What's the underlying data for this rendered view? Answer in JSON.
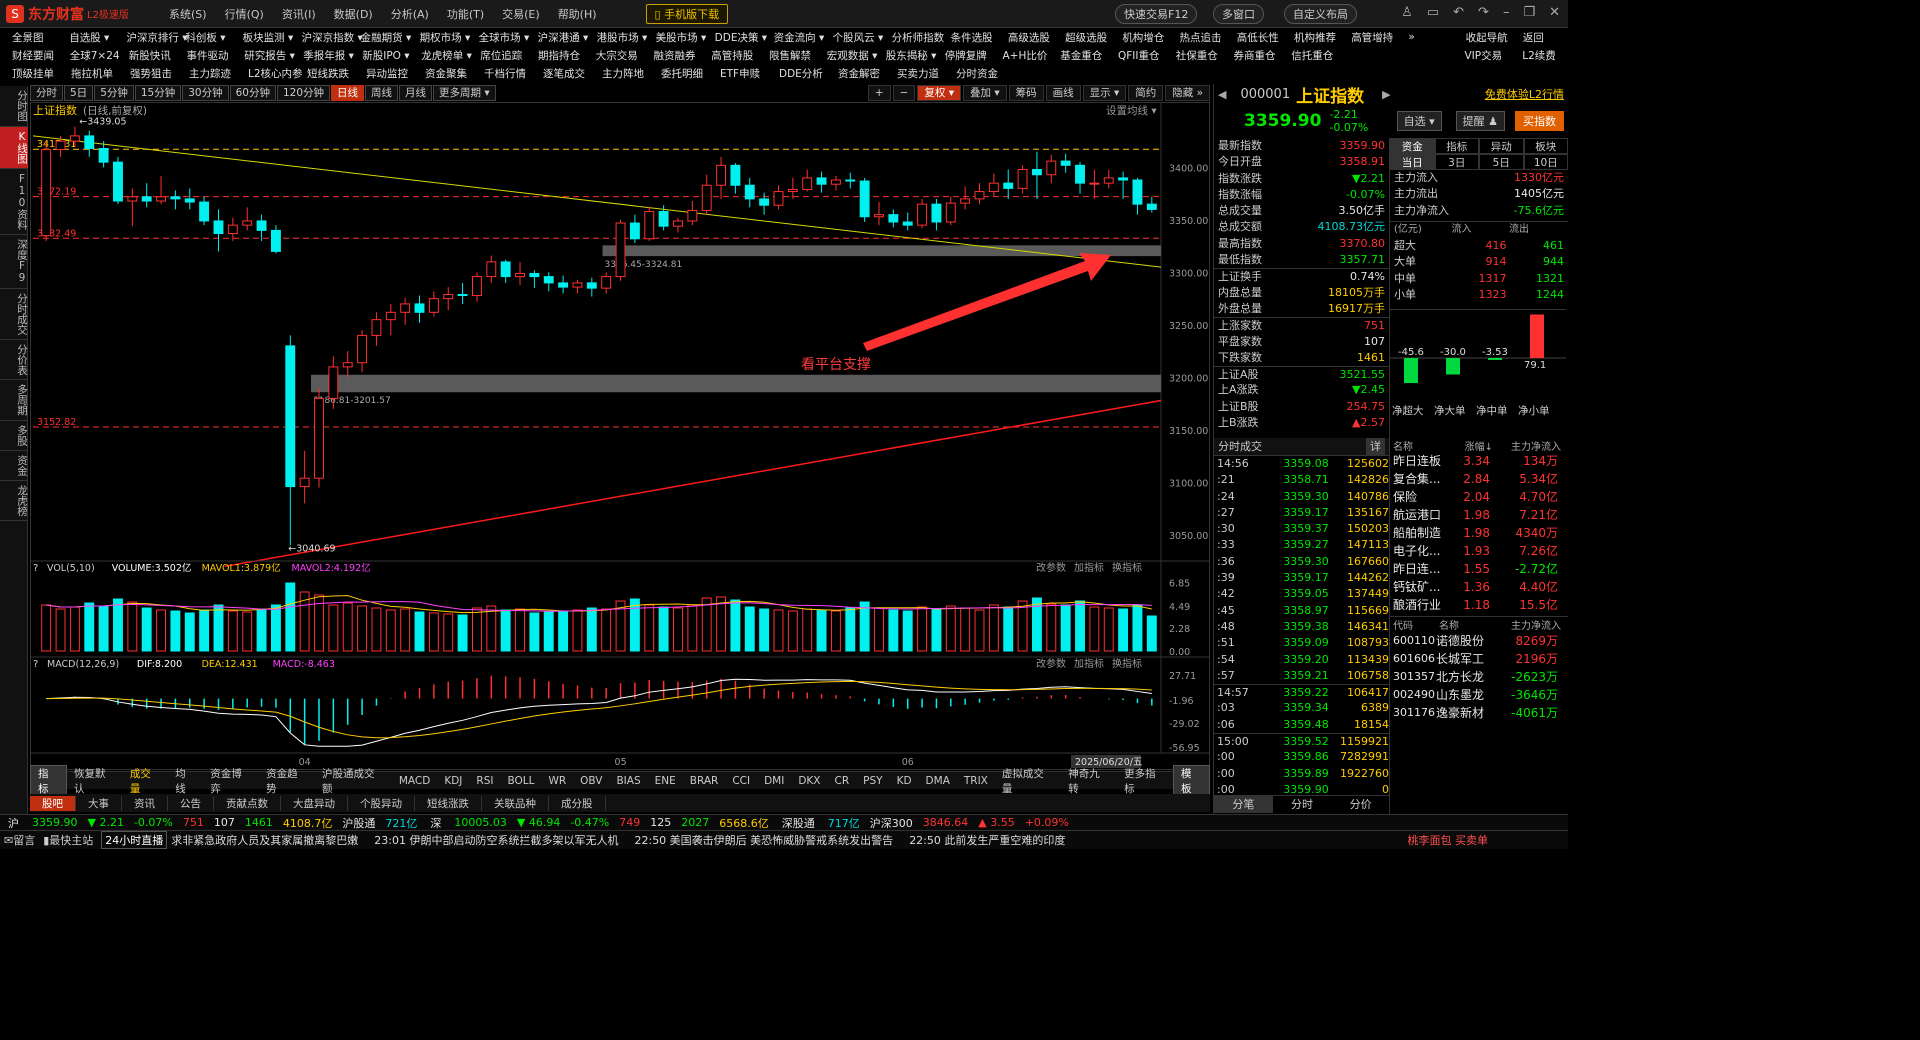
{
  "app": {
    "logo_icon": "S",
    "name": "东方财富",
    "version": "L2极速版",
    "menu": [
      "系统(S)",
      "行情(Q)",
      "资讯(I)",
      "数据(D)",
      "分析(A)",
      "功能(T)",
      "交易(E)",
      "帮助(H)"
    ],
    "mobile_download": "手机版下载",
    "quick_trade": "快速交易F12",
    "multi_window": "多窗口",
    "custom_layout": "自定义布局"
  },
  "nav_row1": [
    "全景图",
    "自选股 ▾",
    "沪深京排行 ▾",
    "科创板 ▾",
    "板块监测 ▾",
    "沪深京指数 ▾",
    "金融期货 ▾",
    "期权市场 ▾",
    "全球市场 ▾",
    "沪深港通 ▾",
    "港股市场 ▾",
    "美股市场 ▾",
    "DDE决策 ▾",
    "资金流向 ▾",
    "个股风云 ▾",
    "分析师指数",
    "条件选股",
    "高级选股",
    "超级选股",
    "机构增仓",
    "热点追击",
    "高低长性",
    "机构推荐",
    "高管增持",
    "»",
    "收起导航",
    "返回"
  ],
  "nav_row2": [
    "财经要闻",
    "全球7×24",
    "新股快讯",
    "事件驱动",
    "研究报告 ▾",
    "季报年报 ▾",
    "新股IPO ▾",
    "龙虎榜单 ▾",
    "席位追踪",
    "期指持仓",
    "大宗交易",
    "融资融券",
    "高管持股",
    "限售解禁",
    "宏观数据 ▾",
    "股东揭秘 ▾",
    "停牌复牌",
    "A+H比价",
    "基金重仓",
    "QFII重仓",
    "社保重仓",
    "券商重仓",
    "信托重仓",
    "",
    "",
    "VIP交易",
    "L2续费"
  ],
  "nav_row3": [
    "顶级挂单",
    "拖拉机单",
    "强势狙击",
    "主力踪迹",
    "L2核心内参",
    "短线跌跌",
    "异动监控",
    "资金聚集",
    "千档行情",
    "逐笔成交",
    "主力阵地",
    "委托明细",
    "ETF申赎",
    "DDE分析",
    "资金解密",
    "买卖力道",
    "分时资金"
  ],
  "left_tabs": [
    "分时图",
    "K线图",
    "F10资料",
    "深度F9",
    "分时成交",
    "分价表",
    "多周期",
    "多股",
    "资金",
    "龙虎榜"
  ],
  "toolbar": {
    "periods": [
      "分时",
      "5日",
      "5分钟",
      "15分钟",
      "30分钟",
      "60分钟",
      "120分钟",
      "日线",
      "周线",
      "月线",
      "更多周期 ▾"
    ],
    "active_period": "日线",
    "tools": [
      "+",
      "−",
      "复权 ▾",
      "叠加 ▾",
      "筹码",
      "画线",
      "显示 ▾",
      "简约",
      "隐藏 »"
    ]
  },
  "chart": {
    "title": "上证指数",
    "subtitle": "(日线,前复权)",
    "settings": "设置均线 ▾",
    "annotation": "看平台支撑",
    "ylabels": [
      "3400.00",
      "3350.00",
      "3300.00",
      "3250.00",
      "3200.00",
      "3150.00",
      "3100.00",
      "3050.00"
    ],
    "yvalues": [
      3400,
      3350,
      3300,
      3250,
      3200,
      3150,
      3100,
      3050
    ],
    "levels": [
      {
        "value": 3417.31,
        "label": "3417.31",
        "color": "#ffcc00"
      },
      {
        "value": 3372.19,
        "label": "3372.19",
        "color": "#ff3030"
      },
      {
        "value": 3332.49,
        "label": "3332.49",
        "color": "#ff3030"
      },
      {
        "value": 3152.82,
        "label": "3152.82",
        "color": "#ff3030"
      }
    ],
    "zones": [
      {
        "low": 3316.45,
        "high": 3324.81,
        "label": "3316.45-3324.81"
      },
      {
        "low": 3186.81,
        "high": 3201.57,
        "label": "3186.81-3201.57"
      }
    ],
    "high_label": "3439.05",
    "low_label": "3040.69",
    "xlabels": [
      "04",
      "05",
      "06"
    ],
    "date_label": "2025/06/20/五",
    "vol_header": [
      {
        "t": "VOL(5,10)",
        "c": "#ccc"
      },
      {
        "t": "VOLUME:3.502亿",
        "c": "#fff"
      },
      {
        "t": "MAVOL1:3.879亿",
        "c": "#ffcc00"
      },
      {
        "t": "MAVOL2:4.192亿",
        "c": "#ff40ff"
      }
    ],
    "vol_ylabels": [
      "6.85",
      "4.49",
      "2.28",
      "0.00"
    ],
    "macd_header": [
      {
        "t": "MACD(12,26,9)",
        "c": "#ccc"
      },
      {
        "t": "DIF:8.200",
        "c": "#fff"
      },
      {
        "t": "DEA:12.431",
        "c": "#ffcc00"
      },
      {
        "t": "MACD:-8.463",
        "c": "#ff40ff"
      }
    ],
    "macd_ylabels": [
      "27.71",
      "-1.96",
      "-29.02",
      "-56.95"
    ],
    "sub_tools": [
      "改参数",
      "加指标",
      "换指标"
    ]
  },
  "chart_data": {
    "type": "candlestick",
    "candles": [
      [
        3335,
        3417,
        3425,
        3330
      ],
      [
        3417,
        3425,
        3430,
        3410
      ],
      [
        3425,
        3430,
        3439,
        3420
      ],
      [
        3430,
        3418,
        3435,
        3410
      ],
      [
        3418,
        3405,
        3425,
        3400
      ],
      [
        3405,
        3368,
        3410,
        3365
      ],
      [
        3368,
        3372,
        3380,
        3344
      ],
      [
        3372,
        3368,
        3385,
        3362
      ],
      [
        3368,
        3372,
        3392,
        3365
      ],
      [
        3372,
        3370,
        3378,
        3360
      ],
      [
        3370,
        3367,
        3380,
        3360
      ],
      [
        3367,
        3349,
        3372,
        3345
      ],
      [
        3349,
        3337,
        3360,
        3320
      ],
      [
        3337,
        3345,
        3352,
        3330
      ],
      [
        3345,
        3349,
        3362,
        3340
      ],
      [
        3349,
        3340,
        3355,
        3330
      ],
      [
        3340,
        3320,
        3345,
        3318
      ],
      [
        3230,
        3096,
        3240,
        3040
      ],
      [
        3096,
        3104,
        3130,
        3080
      ],
      [
        3104,
        3180,
        3190,
        3095
      ],
      [
        3180,
        3210,
        3220,
        3170
      ],
      [
        3210,
        3214,
        3225,
        3200
      ],
      [
        3214,
        3240,
        3245,
        3205
      ],
      [
        3240,
        3255,
        3262,
        3230
      ],
      [
        3255,
        3262,
        3270,
        3240
      ],
      [
        3262,
        3270,
        3276,
        3250
      ],
      [
        3270,
        3262,
        3278,
        3252
      ],
      [
        3262,
        3275,
        3282,
        3258
      ],
      [
        3275,
        3279,
        3286,
        3264
      ],
      [
        3279,
        3278,
        3290,
        3270
      ],
      [
        3278,
        3296,
        3300,
        3272
      ],
      [
        3296,
        3310,
        3316,
        3290
      ],
      [
        3310,
        3296,
        3312,
        3290
      ],
      [
        3296,
        3299,
        3310,
        3288
      ],
      [
        3299,
        3296,
        3302,
        3285
      ],
      [
        3296,
        3290,
        3300,
        3282
      ],
      [
        3290,
        3286,
        3297,
        3280
      ],
      [
        3286,
        3290,
        3293,
        3280
      ],
      [
        3290,
        3285,
        3295,
        3277
      ],
      [
        3285,
        3296,
        3300,
        3280
      ],
      [
        3296,
        3347,
        3350,
        3292
      ],
      [
        3347,
        3332,
        3355,
        3328
      ],
      [
        3332,
        3358,
        3362,
        3330
      ],
      [
        3358,
        3344,
        3364,
        3340
      ],
      [
        3344,
        3349,
        3352,
        3338
      ],
      [
        3349,
        3359,
        3368,
        3345
      ],
      [
        3359,
        3383,
        3393,
        3355
      ],
      [
        3383,
        3402,
        3410,
        3370
      ],
      [
        3402,
        3383,
        3404,
        3375
      ],
      [
        3383,
        3370,
        3390,
        3362
      ],
      [
        3370,
        3364,
        3376,
        3355
      ],
      [
        3364,
        3377,
        3383,
        3360
      ],
      [
        3377,
        3379,
        3390,
        3370
      ],
      [
        3379,
        3390,
        3398,
        3377
      ],
      [
        3390,
        3384,
        3396,
        3376
      ],
      [
        3384,
        3388,
        3392,
        3378
      ],
      [
        3388,
        3387,
        3395,
        3380
      ],
      [
        3387,
        3353,
        3390,
        3348
      ],
      [
        3353,
        3355,
        3367,
        3345
      ],
      [
        3355,
        3348,
        3360,
        3343
      ],
      [
        3348,
        3345,
        3357,
        3340
      ],
      [
        3345,
        3365,
        3370,
        3342
      ],
      [
        3365,
        3348,
        3370,
        3340
      ],
      [
        3348,
        3366,
        3372,
        3345
      ],
      [
        3366,
        3370,
        3382,
        3360
      ],
      [
        3370,
        3377,
        3385,
        3365
      ],
      [
        3377,
        3385,
        3394,
        3372
      ],
      [
        3385,
        3380,
        3398,
        3370
      ],
      [
        3380,
        3398,
        3402,
        3375
      ],
      [
        3398,
        3393,
        3415,
        3370
      ],
      [
        3393,
        3406,
        3412,
        3385
      ],
      [
        3406,
        3402,
        3413,
        3395
      ],
      [
        3402,
        3385,
        3405,
        3375
      ],
      [
        3385,
        3385,
        3398,
        3370
      ],
      [
        3385,
        3390,
        3398,
        3380
      ],
      [
        3390,
        3388,
        3396,
        3370
      ],
      [
        3388,
        3365,
        3390,
        3355
      ],
      [
        3365,
        3360,
        3372,
        3357
      ]
    ],
    "vol": [
      4.6,
      4.2,
      4.4,
      4.8,
      4.5,
      5.2,
      4.9,
      4.3,
      4.1,
      4.0,
      3.8,
      4.1,
      4.6,
      4.0,
      3.9,
      4.2,
      4.6,
      6.8,
      5.9,
      5.6,
      4.6,
      4.8,
      4.5,
      4.3,
      4.1,
      4.2,
      3.9,
      3.8,
      3.7,
      3.6,
      4.3,
      4.5,
      4.1,
      4.2,
      3.8,
      3.9,
      4.0,
      4.1,
      4.3,
      4.2,
      5.0,
      5.2,
      4.6,
      4.4,
      4.3,
      4.6,
      5.3,
      5.4,
      5.1,
      4.4,
      4.2,
      4.1,
      4.0,
      4.2,
      4.1,
      4.0,
      4.3,
      4.9,
      4.3,
      4.1,
      4.0,
      4.4,
      4.2,
      4.5,
      4.3,
      4.1,
      4.6,
      4.4,
      5.0,
      5.3,
      4.7,
      4.6,
      5.0,
      4.4,
      4.3,
      4.2,
      4.6,
      3.5
    ],
    "trend_down": [
      [
        3430,
        0
      ],
      [
        3305,
        1
      ]
    ],
    "trend_up": [
      [
        3020,
        0.17
      ],
      [
        3178,
        1
      ]
    ]
  },
  "quote": {
    "code": "000001",
    "name": "上证指数",
    "price": "3359.90",
    "change": "-2.21",
    "pct": "-0.07%",
    "l2_link": "免费体验L2行情",
    "watch": "自选 ▾",
    "alert": "提醒 ♟",
    "buy": "买指数"
  },
  "quote_rows": [
    {
      "k": "最新指数",
      "v": "3359.90",
      "c": "red"
    },
    {
      "k": "今日开盘",
      "v": "3358.91",
      "c": "red"
    },
    {
      "k": "指数涨跌",
      "v": "▼2.21",
      "c": "green"
    },
    {
      "k": "指数涨幅",
      "v": "-0.07%",
      "c": "green"
    },
    {
      "k": "总成交量",
      "v": "3.50亿手",
      "c": "white"
    },
    {
      "k": "总成交额",
      "v": "4108.73亿元",
      "c": "cyan"
    },
    {
      "k": "最高指数",
      "v": "3370.80",
      "c": "red"
    },
    {
      "k": "最低指数",
      "v": "3357.71",
      "c": "green"
    },
    {
      "k": "上证换手",
      "v": "0.74%",
      "c": "white"
    },
    {
      "k": "内盘总量",
      "v": "18105万手",
      "c": "yellow"
    },
    {
      "k": "外盘总量",
      "v": "16917万手",
      "c": "yellow"
    },
    {
      "k": "上涨家数",
      "v": "751",
      "c": "red"
    },
    {
      "k": "平盘家数",
      "v": "107",
      "c": "white"
    },
    {
      "k": "下跌家数",
      "v": "1461",
      "c": "yellow"
    },
    {
      "k": "上证A股",
      "v": "3521.55",
      "c": "green"
    },
    {
      "k": "上A涨跌",
      "v": "▼2.45",
      "c": "green"
    },
    {
      "k": "上证B股",
      "v": "254.75",
      "c": "red"
    },
    {
      "k": "上B涨跌",
      "v": "▲2.57",
      "c": "red"
    }
  ],
  "fund_tabs": [
    "资金",
    "指标",
    "异动",
    "板块"
  ],
  "fund_period": [
    "当日",
    "3日",
    "5日",
    "10日"
  ],
  "fund_rows": [
    {
      "k": "主力流入",
      "v": "1330亿元",
      "c": "red"
    },
    {
      "k": "主力流出",
      "v": "1405亿元",
      "c": "white"
    },
    {
      "k": "主力净流入",
      "v": "-75.6亿元",
      "c": "green"
    }
  ],
  "flow_header": [
    "(亿元)",
    "流入",
    "流出"
  ],
  "flow_rows": [
    [
      "超大",
      "416",
      "461"
    ],
    [
      "大单",
      "914",
      "944"
    ],
    [
      "中单",
      "1317",
      "1321"
    ],
    [
      "小单",
      "1323",
      "1244"
    ]
  ],
  "net_bars": {
    "values": [
      -45.6,
      -30.0,
      -3.53,
      79.1
    ],
    "labels": [
      "-45.6",
      "-30.0",
      "-3.53",
      "79.1"
    ],
    "names": [
      "净超大",
      "净大单",
      "净中单",
      "净小单"
    ]
  },
  "ticks_title": "分时成交",
  "ticks_more": "详",
  "ticks": [
    [
      "14:56",
      "3359.08",
      "125602"
    ],
    [
      ":21",
      "3358.71",
      "142826"
    ],
    [
      ":24",
      "3359.30",
      "140786"
    ],
    [
      ":27",
      "3359.17",
      "135167"
    ],
    [
      ":30",
      "3359.37",
      "150203"
    ],
    [
      ":33",
      "3359.27",
      "147113"
    ],
    [
      ":36",
      "3359.30",
      "167660"
    ],
    [
      ":39",
      "3359.17",
      "144262"
    ],
    [
      ":42",
      "3359.05",
      "137449"
    ],
    [
      ":45",
      "3358.97",
      "115669"
    ],
    [
      ":48",
      "3359.38",
      "146341"
    ],
    [
      ":51",
      "3359.09",
      "108793"
    ],
    [
      ":54",
      "3359.20",
      "113439"
    ],
    [
      ":57",
      "3359.21",
      "106758"
    ],
    [
      "14:57",
      "3359.22",
      "106417"
    ],
    [
      ":03",
      "3359.34",
      "6389"
    ],
    [
      ":06",
      "3359.48",
      "18154"
    ],
    [
      "15:00",
      "3359.52",
      "1159921"
    ],
    [
      ":00",
      "3359.86",
      "7282991"
    ],
    [
      ":00",
      "3359.89",
      "1922760"
    ],
    [
      ":00",
      "3359.90",
      "0"
    ]
  ],
  "tick_tabs": [
    "分笔",
    "分时",
    "分价"
  ],
  "sectors_header": [
    "名称",
    "涨幅↓",
    "主力净流入"
  ],
  "sectors": [
    [
      "昨日连板",
      "3.34",
      "134万",
      "red"
    ],
    [
      "复合集...",
      "2.84",
      "5.34亿",
      "red"
    ],
    [
      "保险",
      "2.04",
      "4.70亿",
      "red"
    ],
    [
      "航运港口",
      "1.98",
      "7.21亿",
      "red"
    ],
    [
      "船舶制造",
      "1.98",
      "4340万",
      "red"
    ],
    [
      "电子化...",
      "1.93",
      "7.26亿",
      "red"
    ],
    [
      "昨日连...",
      "1.55",
      "-2.72亿",
      "green"
    ],
    [
      "钙钛矿...",
      "1.36",
      "4.40亿",
      "red"
    ],
    [
      "酿酒行业",
      "1.18",
      "15.5亿",
      "red"
    ]
  ],
  "stocks_header": [
    "代码",
    "名称",
    "主力净流入"
  ],
  "stocks": [
    [
      "600110",
      "诺德股份",
      "8269万",
      "red"
    ],
    [
      "601606",
      "长城军工",
      "2196万",
      "red"
    ],
    [
      "301357",
      "北方长龙",
      "-2623万",
      "green"
    ],
    [
      "002490",
      "山东墨龙",
      "-3646万",
      "green"
    ],
    [
      "301176",
      "逸豪新材",
      "-4061万",
      "green"
    ]
  ],
  "ind_tabs": [
    "指标",
    "恢复默认",
    "成交量",
    "均线",
    "资金博弈",
    "资金趋势",
    "沪股通成交额",
    "MACD",
    "KDJ",
    "RSI",
    "BOLL",
    "WR",
    "OBV",
    "BIAS",
    "ENE",
    "BRAR",
    "CCI",
    "DMI",
    "DKX",
    "CR",
    "PSY",
    "KD",
    "DMA",
    "TRIX",
    "虚拟成交量",
    "神奇九转",
    "更多指标",
    "模板"
  ],
  "news_tabs": [
    "股吧",
    "大事",
    "资讯",
    "公告",
    "贡献点数",
    "大盘异动",
    "个股异动",
    "短线涨跌",
    "关联品种",
    "成分股"
  ],
  "status": [
    {
      "t": "沪",
      "c": "white"
    },
    {
      "t": "3359.90",
      "c": "green"
    },
    {
      "t": "▼ 2.21",
      "c": "green"
    },
    {
      "t": "-0.07%",
      "c": "green"
    },
    {
      "t": "751",
      "c": "red"
    },
    {
      "t": "107",
      "c": "white"
    },
    {
      "t": "1461",
      "c": "green"
    },
    {
      "t": "4108.7亿",
      "c": "yellow"
    },
    {
      "t": "沪股通",
      "c": "white"
    },
    {
      "t": "721亿",
      "c": "cyan"
    },
    {
      "t": "深",
      "c": "white"
    },
    {
      "t": "10005.03",
      "c": "green"
    },
    {
      "t": "▼ 46.94",
      "c": "green"
    },
    {
      "t": "-0.47%",
      "c": "green"
    },
    {
      "t": "749",
      "c": "red"
    },
    {
      "t": "125",
      "c": "white"
    },
    {
      "t": "2027",
      "c": "green"
    },
    {
      "t": "6568.6亿",
      "c": "yellow"
    },
    {
      "t": "深股通",
      "c": "white"
    },
    {
      "t": "717亿",
      "c": "cyan"
    },
    {
      "t": "沪深300",
      "c": "white"
    },
    {
      "t": "3846.64",
      "c": "red"
    },
    {
      "t": "▲ 3.55",
      "c": "red"
    },
    {
      "t": "+0.09%",
      "c": "red"
    }
  ],
  "ticker": {
    "msg": "留言",
    "min": "最快主站",
    "live": "24小时直播",
    "items": [
      "求非紧急政府人员及其家属撤离黎巴嫩",
      "23:01 伊朗中部启动防空系统拦截多架以军无人机",
      "22:50 美国袭击伊朗后 美恐怖威胁警戒系统发出警告",
      "22:50 此前发生严重空难的印度"
    ],
    "right": "桃李面包 买卖单"
  }
}
